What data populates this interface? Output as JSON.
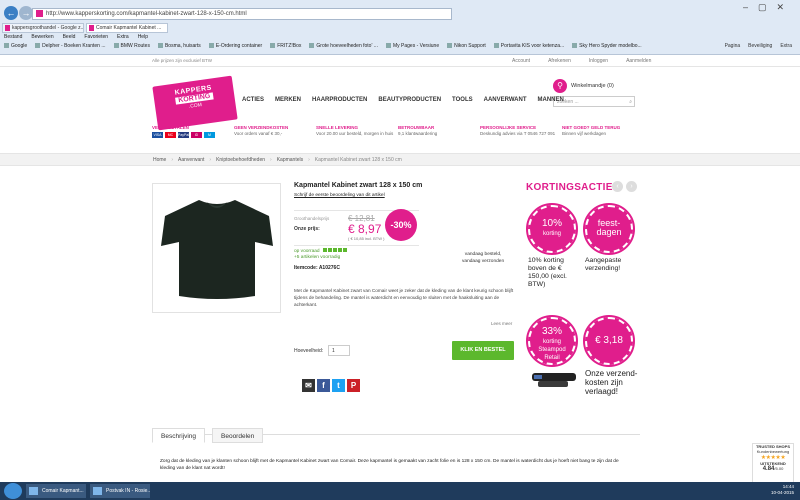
{
  "browser": {
    "url": "http://www.kapperskorting.com/kapmantel-kabinet-zwart-128-x-150-cm.html",
    "tabs": [
      {
        "title": "kappersgroothandel - Google z..."
      },
      {
        "title": "Comair Kapmantel Kabinet ..."
      }
    ],
    "menu": [
      "Bestand",
      "Bewerken",
      "Beeld",
      "Favorieten",
      "Extra",
      "Help"
    ],
    "favorites": [
      "Google",
      "Delpher - Boeken Kranten ...",
      "BMW Routes",
      "Bosma, huisarts",
      "E-Ordering container",
      "FRITZ!Box",
      "Grote hoeveelheden foto' ...",
      "My Pages - Versiune",
      "Nikon Support",
      "Portavita KIS voor ketenza...",
      "Sky Hero Spyder modelbo..."
    ],
    "right_tools": [
      "Pagina",
      "Beveiliging",
      "Extra"
    ]
  },
  "site": {
    "top_note": "Alle prijzen zijn exclusief BTW",
    "top_links": [
      "Account",
      "Afrekenen",
      "Inloggen",
      "Aanmelden"
    ],
    "logo": {
      "line1": "KAPPERS",
      "line2": "KORTING",
      "line3": ".COM"
    },
    "cart_label": "Winkelmandje (0)",
    "search_placeholder": "zoeken ...",
    "nav": [
      "ACTIES",
      "MERKEN",
      "HAARPRODUCTEN",
      "BEAUTYPRODUCTEN",
      "TOOLS",
      "AANVERWANT",
      "MANNEN"
    ],
    "usps": [
      {
        "title": "VEILIG BETALEN",
        "text": ""
      },
      {
        "title": "GEEN VERZENDKOSTEN",
        "text": "Voor orders vanaf € 30,-"
      },
      {
        "title": "SNELLE LEVERING",
        "text": "Voor 20.00 uur besteld, morgen in huis"
      },
      {
        "title": "BETROUWBAAR",
        "text": "9,1 klantwaardering"
      },
      {
        "title": "PERSOONLIJKE SERVICE",
        "text": "Deskundig advies via T 0546 727 091"
      },
      {
        "title": "NIET GOED? GELD TERUG",
        "text": "Binnen vijf werkdagen"
      }
    ],
    "pay_logos": [
      "VISA",
      "MC",
      "PayPal",
      "iD",
      "M"
    ],
    "breadcrumbs": [
      "Home",
      "Aanverwant",
      "Kniptoebehoefdheden",
      "Kapmantels"
    ],
    "breadcrumb_current": "Kapmantel Kabinet zwart 128 x 150 cm",
    "product": {
      "title": "Kapmantel Kabinet zwart 128 x 150 cm",
      "review_link": "Schrijf de eerste beoordeling van dit artikel",
      "old_label": "Groothandelsprijs",
      "old_price": "€ 12,81",
      "price_label": "Onze prijs:",
      "price": "€ 8,97",
      "price_incl": "( € 10,85 incl. BTW )",
      "discount": "-30%",
      "stock": "op voorraad",
      "stock_count": "+5 artikelen voorradig",
      "item_code": "Itemcode: A10276C",
      "delivery_line1": "vandaag besteld,",
      "delivery_line2": "vandaag verzonden",
      "description": "Met de Kapmantel Kabinet zwart van Comair weet je zeker dat de kleding van de klant keurig schoon blijft tijdens de behandeling. De mantel is waterdicht en eenvoudig te sluiten met de haaksluiting aan de achterkant.",
      "read_more": "Lees meer",
      "qty_label": "Hoeveelheid:",
      "qty": "1",
      "buy_label": "KLIK EN BESTEL",
      "color": "#1c2620"
    },
    "side": {
      "heading": "KORTINGSACTIES",
      "promos": [
        {
          "c1": "10%",
          "c2": "korting",
          "text": "10% korting boven de € 150,00 (excl. BTW)"
        },
        {
          "c1": "feest-",
          "c2": "dagen",
          "text": "Aangepaste verzending!"
        },
        {
          "c1": "33%",
          "c2": "korting Steampod Retail",
          "text": ""
        },
        {
          "c1": "€ 3,18",
          "c2": "",
          "text": "Onze verzend-kosten zijn verlaagd!"
        }
      ]
    },
    "tabs": [
      "Beschrijving",
      "Beoordelen"
    ],
    "tab_text": "Zorg dat de kleding van je klanten schoon blijft met de Kapmantel Kabinet zwart van Comair. Deze kapmantel is gemaakt van zacht folie en is 128 x 150 cm. De mantel is waterdicht dus je hoeft niet bang te zijn dat de kleding van de klant nat wordt!",
    "trust": {
      "title": "TRUSTED SHOPS",
      "sub": "Kundenbewertung",
      "label": "UITSTEKEND",
      "score": "4.84",
      "max": "/5.00"
    }
  },
  "taskbar": {
    "items": [
      "Comair Kapmant...",
      "Postvak IN - Rosie..."
    ],
    "time": "14:44",
    "date": "10-04-2015"
  },
  "colors": {
    "brand": "#e01e8c",
    "buy": "#5cb82d"
  }
}
